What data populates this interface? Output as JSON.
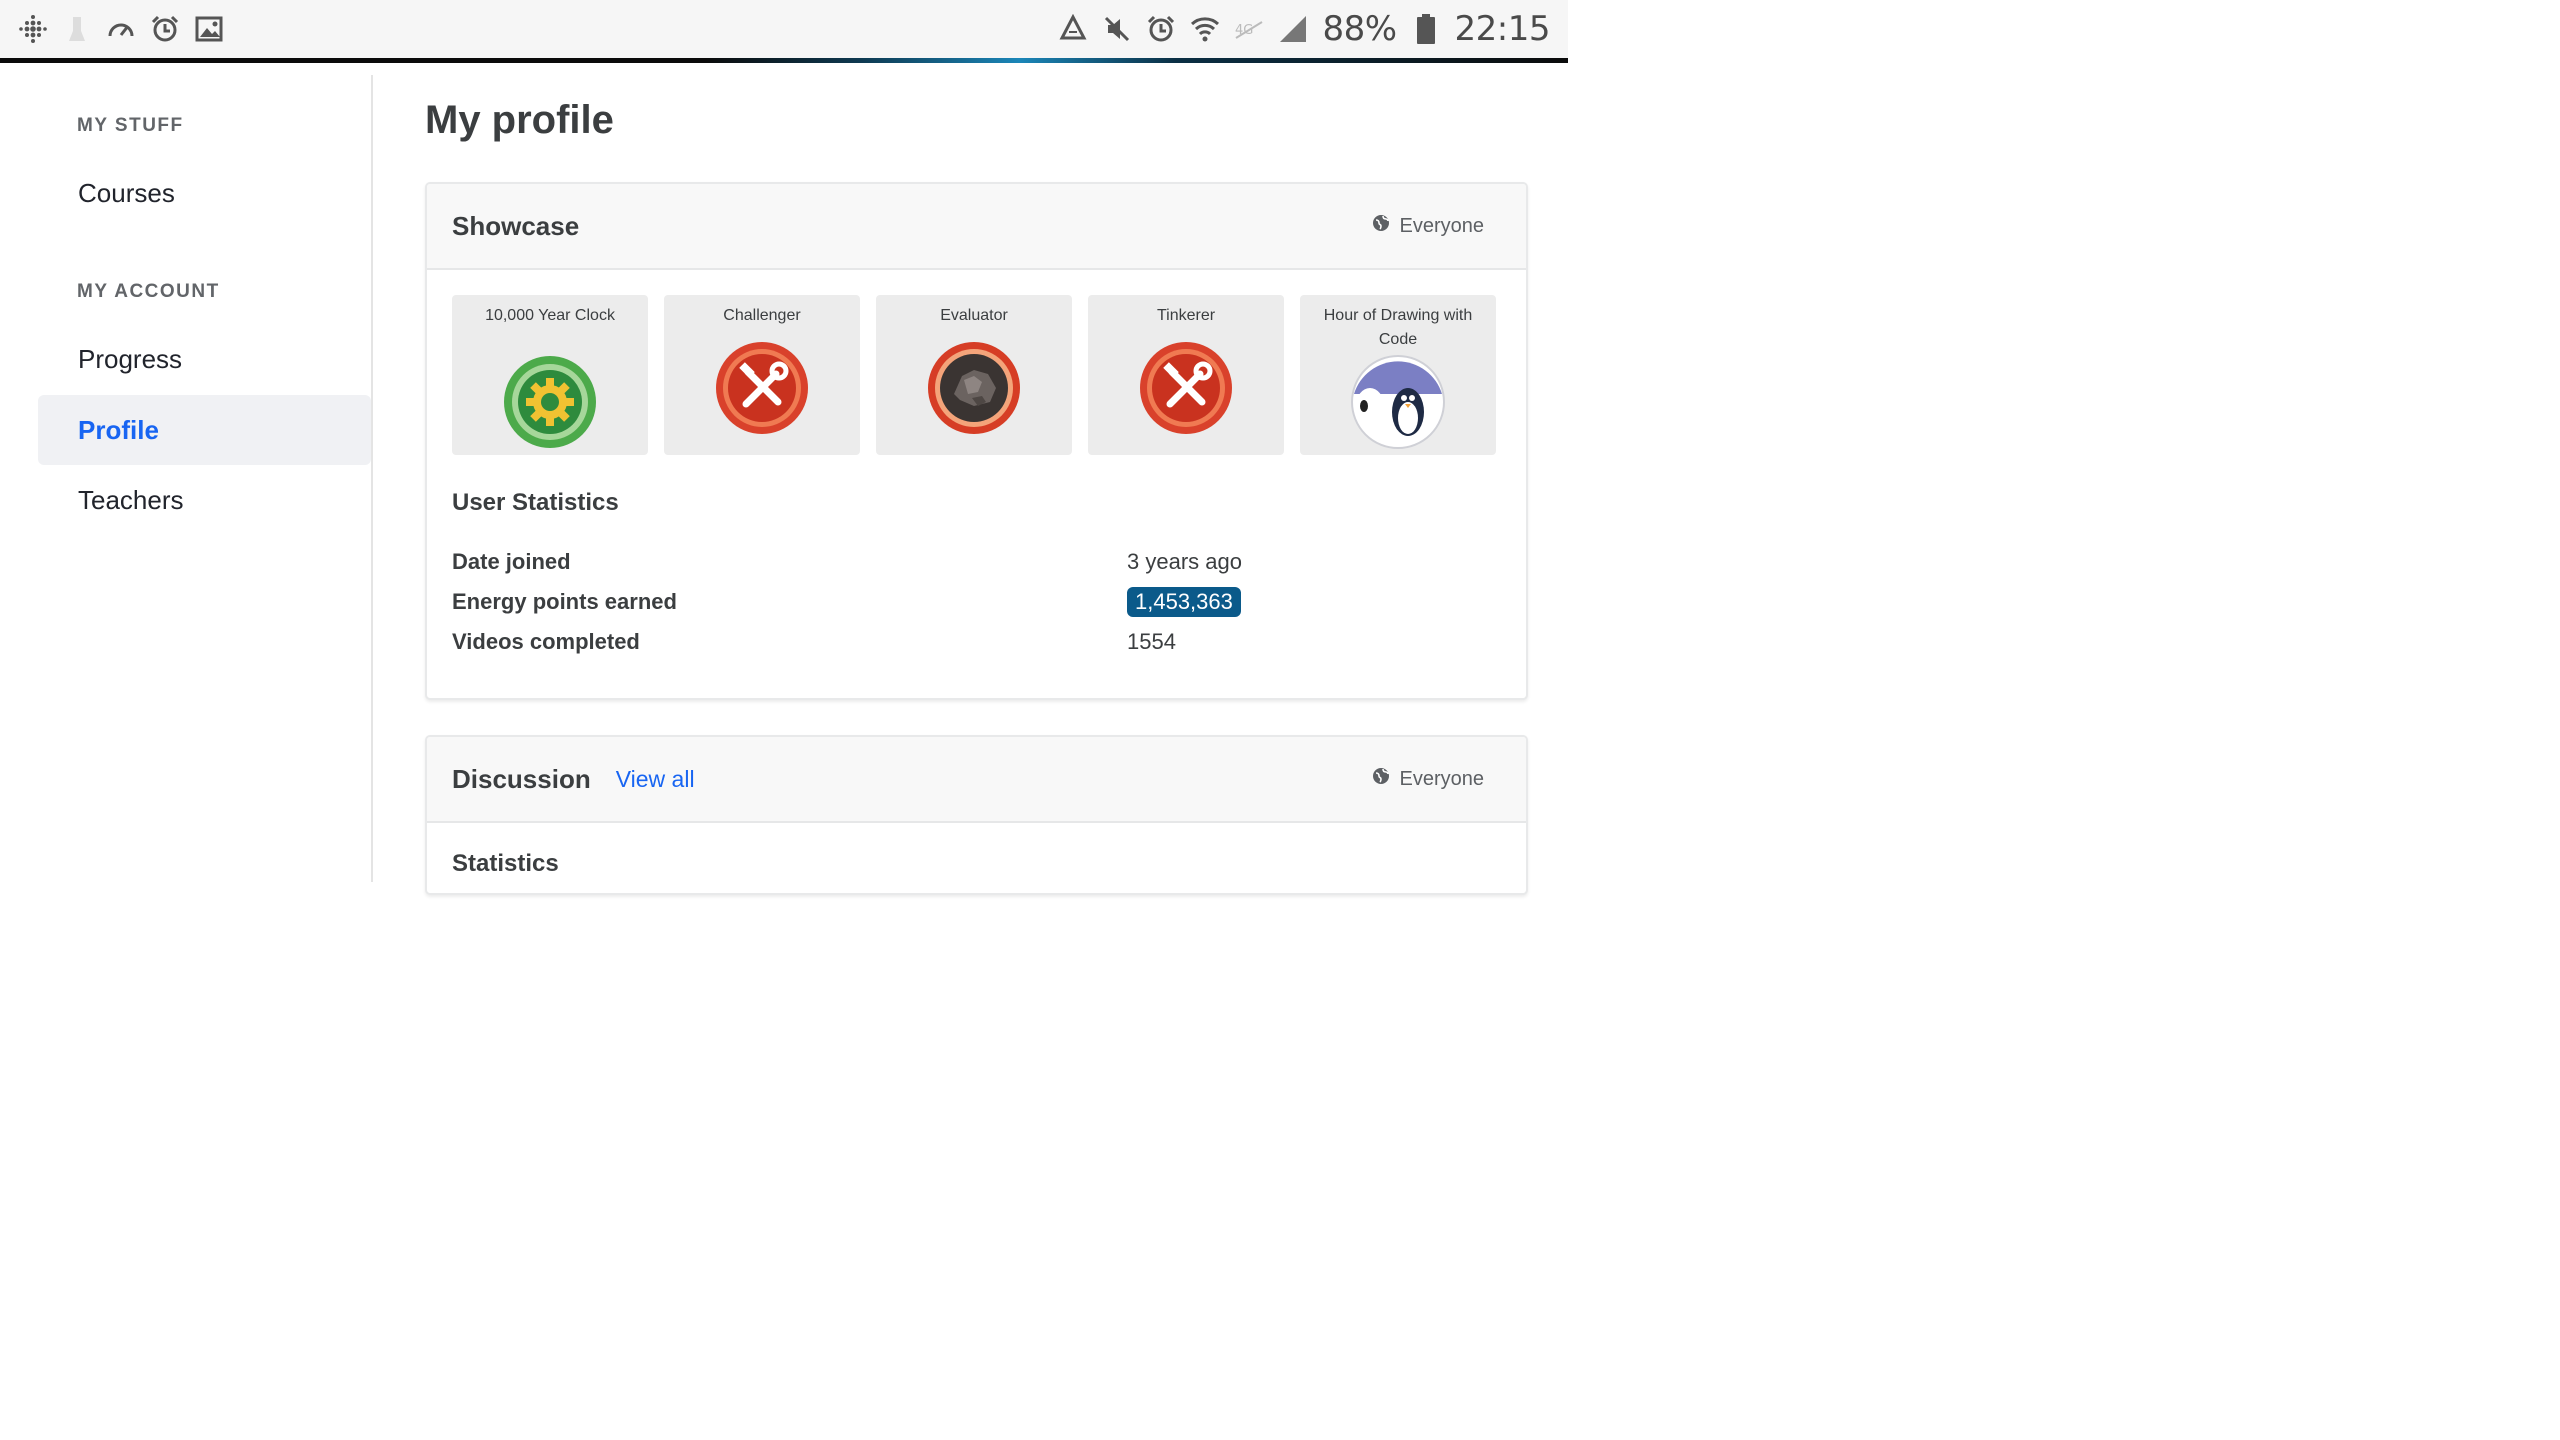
{
  "status_bar": {
    "left_icons": [
      "fitbit-icon",
      "stimuli-icon",
      "speedometer-icon",
      "alarm-icon",
      "image-icon"
    ],
    "right_icons": [
      "recycle-icon",
      "mute-icon",
      "alarm-icon",
      "wifi-icon",
      "data-off-icon",
      "signal-icon",
      "battery-icon"
    ],
    "battery": "88%",
    "time": "22:15"
  },
  "sidebar": {
    "my_stuff_heading": "MY STUFF",
    "my_account_heading": "MY ACCOUNT",
    "items": [
      {
        "label": "Courses"
      },
      {
        "label": "Progress"
      },
      {
        "label": "Profile",
        "active": true
      },
      {
        "label": "Teachers"
      }
    ]
  },
  "main": {
    "page_title": "My profile",
    "showcase": {
      "title": "Showcase",
      "visibility": "Everyone",
      "badges": [
        {
          "title": "10,000 Year Clock",
          "icon": "gear-badge-icon"
        },
        {
          "title": "Challenger",
          "icon": "tools-badge-icon"
        },
        {
          "title": "Evaluator",
          "icon": "rock-badge-icon"
        },
        {
          "title": "Tinkerer",
          "icon": "tools-badge-icon"
        },
        {
          "title": "Hour of Drawing with Code",
          "icon": "penguin-badge-icon"
        }
      ],
      "user_statistics": {
        "title": "User Statistics",
        "rows": [
          {
            "label": "Date joined",
            "value": "3 years ago"
          },
          {
            "label": "Energy points earned",
            "value": "1,453,363"
          },
          {
            "label": "Videos completed",
            "value": "1554"
          }
        ]
      }
    },
    "discussion": {
      "title": "Discussion",
      "view_all": "View all",
      "visibility": "Everyone",
      "statistics_title": "Statistics"
    }
  },
  "colors": {
    "accent_blue": "#1865f2",
    "points_pill": "#0b5a8a",
    "sidebar_active_bg": "#f0f1f4"
  }
}
